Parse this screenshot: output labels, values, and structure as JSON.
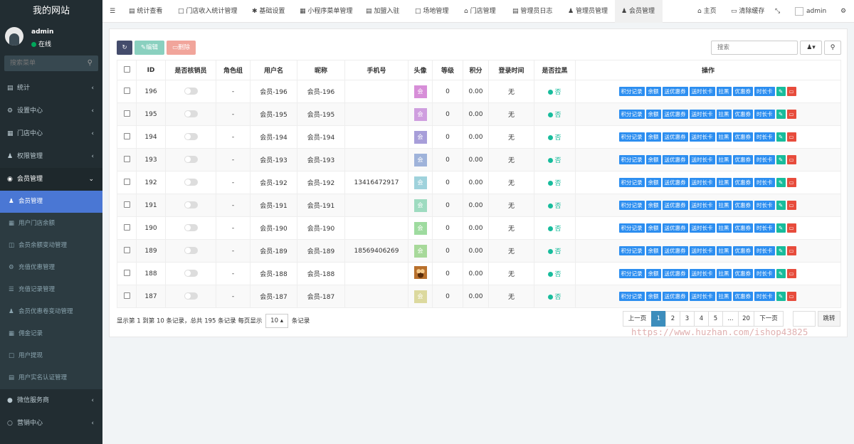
{
  "app": {
    "title": "我的网站"
  },
  "user": {
    "name": "admin",
    "status": "在线"
  },
  "sidebar_search": {
    "placeholder": "搜索菜单"
  },
  "menu": [
    {
      "label": "统计",
      "icon": "bar-chart-icon",
      "expanded": false
    },
    {
      "label": "设置中心",
      "icon": "gears-icon",
      "expanded": false
    },
    {
      "label": "门店中心",
      "icon": "building-icon",
      "expanded": false
    },
    {
      "label": "权限管理",
      "icon": "group-icon",
      "expanded": false
    },
    {
      "label": "会员管理",
      "icon": "user-circle-icon",
      "expanded": true
    }
  ],
  "submenu": [
    {
      "label": "会员管理",
      "icon": "user-icon",
      "active": true
    },
    {
      "label": "用户门店余额",
      "icon": "book-icon",
      "active": false
    },
    {
      "label": "会员余额变动管理",
      "icon": "database-icon",
      "active": false
    },
    {
      "label": "充值优惠管理",
      "icon": "cog-icon",
      "active": false
    },
    {
      "label": "充值记录管理",
      "icon": "list-icon",
      "active": false
    },
    {
      "label": "会员优惠卷变动管理",
      "icon": "user-plus-icon",
      "active": false
    },
    {
      "label": "佣金记录",
      "icon": "money-icon",
      "active": false
    },
    {
      "label": "用户提现",
      "icon": "file-icon",
      "active": false
    },
    {
      "label": "用户实名认证管理",
      "icon": "id-card-icon",
      "active": false
    }
  ],
  "menu_after": [
    {
      "label": "微信服务商",
      "icon": "wechat-icon"
    },
    {
      "label": "营销中心",
      "icon": "globe-icon"
    }
  ],
  "topbar": {
    "tabs": [
      "统计查看",
      "门店收入统计管理",
      "基础设置",
      "小程序菜单管理",
      "加盟入驻",
      "场地管理",
      "门店管理",
      "管理员日志",
      "管理员管理",
      "会员管理"
    ],
    "active_tab": "会员管理",
    "home": "主页",
    "clear_cache": "清除缓存",
    "user": "admin"
  },
  "toolbar": {
    "refresh": "",
    "edit": "编辑",
    "delete": "删除",
    "search_placeholder": "搜索"
  },
  "columns": [
    "",
    "ID",
    "是否核销员",
    "角色组",
    "用户名",
    "昵称",
    "手机号",
    "头像",
    "等级",
    "积分",
    "登录时间",
    "是否拉黑",
    "操作"
  ],
  "rows": [
    {
      "id": "196",
      "role": "-",
      "username": "会员-196",
      "nickname": "会员-196",
      "phone": "",
      "avatar_text": "会",
      "avatar_color": "#d78ed8",
      "level": "0",
      "points": "0.00",
      "login": "无",
      "blacklist": "否"
    },
    {
      "id": "195",
      "role": "-",
      "username": "会员-195",
      "nickname": "会员-195",
      "phone": "",
      "avatar_text": "会",
      "avatar_color": "#cf9edf",
      "level": "0",
      "points": "0.00",
      "login": "无",
      "blacklist": "否"
    },
    {
      "id": "194",
      "role": "-",
      "username": "会员-194",
      "nickname": "会员-194",
      "phone": "",
      "avatar_text": "会",
      "avatar_color": "#a79ed9",
      "level": "0",
      "points": "0.00",
      "login": "无",
      "blacklist": "否"
    },
    {
      "id": "193",
      "role": "-",
      "username": "会员-193",
      "nickname": "会员-193",
      "phone": "",
      "avatar_text": "会",
      "avatar_color": "#9fb3da",
      "level": "0",
      "points": "0.00",
      "login": "无",
      "blacklist": "否"
    },
    {
      "id": "192",
      "role": "-",
      "username": "会员-192",
      "nickname": "会员-192",
      "phone": "13416472917",
      "avatar_text": "会",
      "avatar_color": "#9fd2dc",
      "level": "0",
      "points": "0.00",
      "login": "无",
      "blacklist": "否"
    },
    {
      "id": "191",
      "role": "-",
      "username": "会员-191",
      "nickname": "会员-191",
      "phone": "",
      "avatar_text": "会",
      "avatar_color": "#9edbc0",
      "level": "0",
      "points": "0.00",
      "login": "无",
      "blacklist": "否"
    },
    {
      "id": "190",
      "role": "-",
      "username": "会员-190",
      "nickname": "会员-190",
      "phone": "",
      "avatar_text": "会",
      "avatar_color": "#9edb9f",
      "level": "0",
      "points": "0.00",
      "login": "无",
      "blacklist": "否"
    },
    {
      "id": "189",
      "role": "-",
      "username": "会员-189",
      "nickname": "会员-189",
      "phone": "18569406269",
      "avatar_text": "会",
      "avatar_color": "#a7d99a",
      "level": "0",
      "points": "0.00",
      "login": "无",
      "blacklist": "否"
    },
    {
      "id": "188",
      "role": "-",
      "username": "会员-188",
      "nickname": "会员-188",
      "phone": "",
      "avatar_text": "",
      "avatar_color": "#b8702c",
      "level": "0",
      "points": "0.00",
      "login": "无",
      "blacklist": "否"
    },
    {
      "id": "187",
      "role": "-",
      "username": "会员-187",
      "nickname": "会员-187",
      "phone": "",
      "avatar_text": "会",
      "avatar_color": "#dcd99e",
      "level": "0",
      "points": "0.00",
      "login": "无",
      "blacklist": "否"
    }
  ],
  "row_actions": [
    "积分记录",
    "余额",
    "送优惠券",
    "送时长卡",
    "拉黑",
    "优惠券",
    "时长卡"
  ],
  "footer": {
    "info": "显示第 1 到第 10 条记录，总共 195 条记录 每页显示",
    "page_size": "10",
    "suffix": "条记录"
  },
  "pagination": {
    "prev": "上一页",
    "pages": [
      "1",
      "2",
      "3",
      "4",
      "5",
      "...",
      "20"
    ],
    "next": "下一页",
    "jump": "跳转"
  },
  "watermark": "https://www.huzhan.com/ishop43825",
  "colors": {
    "sidebar": "#222d32",
    "active_sub": "#4a77d4",
    "action": "#2c8ef0",
    "success": "#18bc9c",
    "danger": "#e74c3c"
  }
}
